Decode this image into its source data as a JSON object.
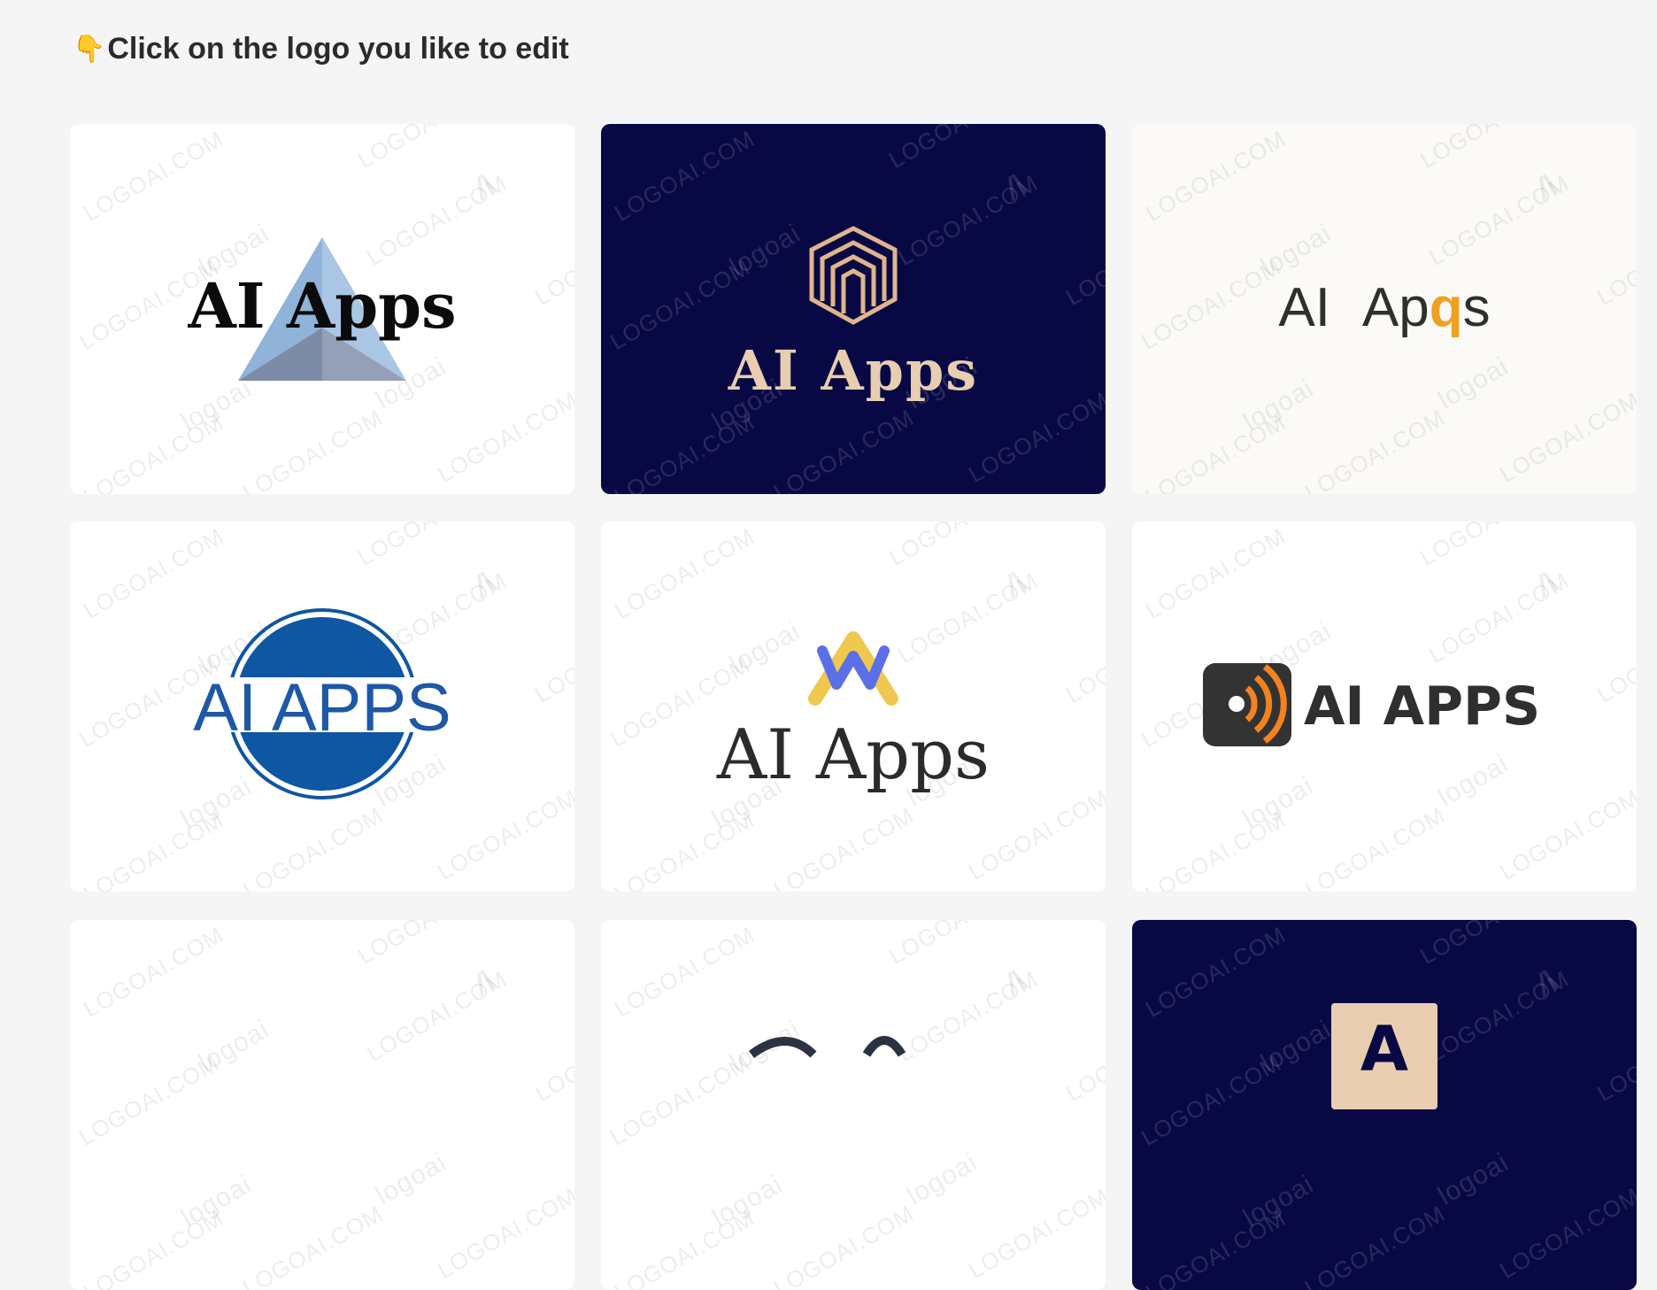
{
  "heading": {
    "pointer_icon": "👇",
    "text": "Click on the logo you like to edit"
  },
  "watermark": {
    "domain_text": "LOGOAI.COM",
    "brand_text": "logoai"
  },
  "cards": [
    {
      "logo_text": "AI Apps",
      "background": "#ffffff",
      "text_color": "#0b0b0b",
      "accent": "#8fb3d9"
    },
    {
      "logo_text": "AI Apps",
      "background": "#080944",
      "text_color": "#e9cdb0",
      "accent": "#e0b58e"
    },
    {
      "logo_text_left": "AI",
      "logo_text_mid": "Ap",
      "logo_text_accent": "q",
      "logo_text_end": "s",
      "background": "#fbfaf7",
      "text_color": "#2f2f2f",
      "accent": "#f0a020"
    },
    {
      "logo_text": "AI APPS",
      "background": "#ffffff",
      "text_color": "#1e58a6",
      "accent": "#0f56a3"
    },
    {
      "logo_text": "AI Apps",
      "background": "#ffffff",
      "text_color": "#2b2b2b",
      "accent": "#5b6fe8",
      "accent2": "#f1c84f"
    },
    {
      "logo_text": "AI APPS",
      "background": "#ffffff",
      "text_color": "#2f2f2f",
      "accent": "#f2831f"
    },
    {
      "logo_text": "",
      "background": "#ffffff"
    },
    {
      "logo_text": "",
      "background": "#ffffff"
    },
    {
      "logo_text": "A",
      "background": "#080944",
      "accent": "#e9cdb0"
    }
  ]
}
